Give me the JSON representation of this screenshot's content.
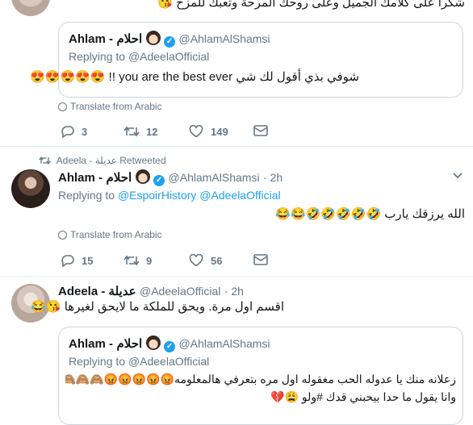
{
  "tweet1": {
    "text_top": "شكرا على كلامك الجميل وعلى روحك المرحة وتعبك للمزح 😘",
    "quote": {
      "name": "Ahlam -",
      "name_ar": "احلام",
      "handle": "@AhlamAlShamsi",
      "replying_label": "Replying to",
      "replying_to": "@AdeelaOfficial",
      "text": "شوفي بذي أقول لك شي you are the best ever !! 😍😍😍😍😍"
    },
    "translate": "Translate from Arabic",
    "actions": {
      "replies": "3",
      "retweets": "12",
      "likes": "149"
    }
  },
  "tweet2": {
    "retweet_label": "Adeela - عديلة Retweeted",
    "name": "Ahlam -",
    "name_ar": "احلام",
    "handle": "@AhlamAlShamsi",
    "time": "· 2h",
    "replying_label": "Replying to",
    "replying_to_1": "@EspoirHistory",
    "replying_to_2": "@AdeelaOfficial",
    "text": "الله يرزقك يارب 🤣🤣🤣🤣🤣😂😂",
    "translate": "Translate from Arabic",
    "actions": {
      "replies": "15",
      "retweets": "9",
      "likes": "56"
    }
  },
  "tweet3": {
    "name": "Adeela - عديلة",
    "handle": "@AdeelaOfficial",
    "time": "· 2h",
    "text": "اقسم اول مرة. ويحق للملكة ما لايحق لغيرها 😘😂",
    "quote": {
      "name": "Ahlam -",
      "name_ar": "احلام",
      "handle": "@AhlamAlShamsi",
      "replying_label": "Replying to",
      "replying_to": "@AdeelaOfficial",
      "text_line1": "زعلانه منك يا عدوله الحب مغقوله اول مره بتعرفي هالمعلومه😡😡😡😡😡🙈🙈🙈💔💔",
      "text_line2": "وانا يقول ما حدا بيحبني قدك #ولو 😩💔"
    }
  },
  "colors": {
    "accent": "#1da1f2",
    "muted": "#657786",
    "border": "#e6ecf0",
    "heart": "#e0245e"
  },
  "icons": [
    "reply-icon",
    "retweet-icon",
    "like-icon",
    "message-icon",
    "chevron-down-icon",
    "globe-icon",
    "verified-icon"
  ]
}
